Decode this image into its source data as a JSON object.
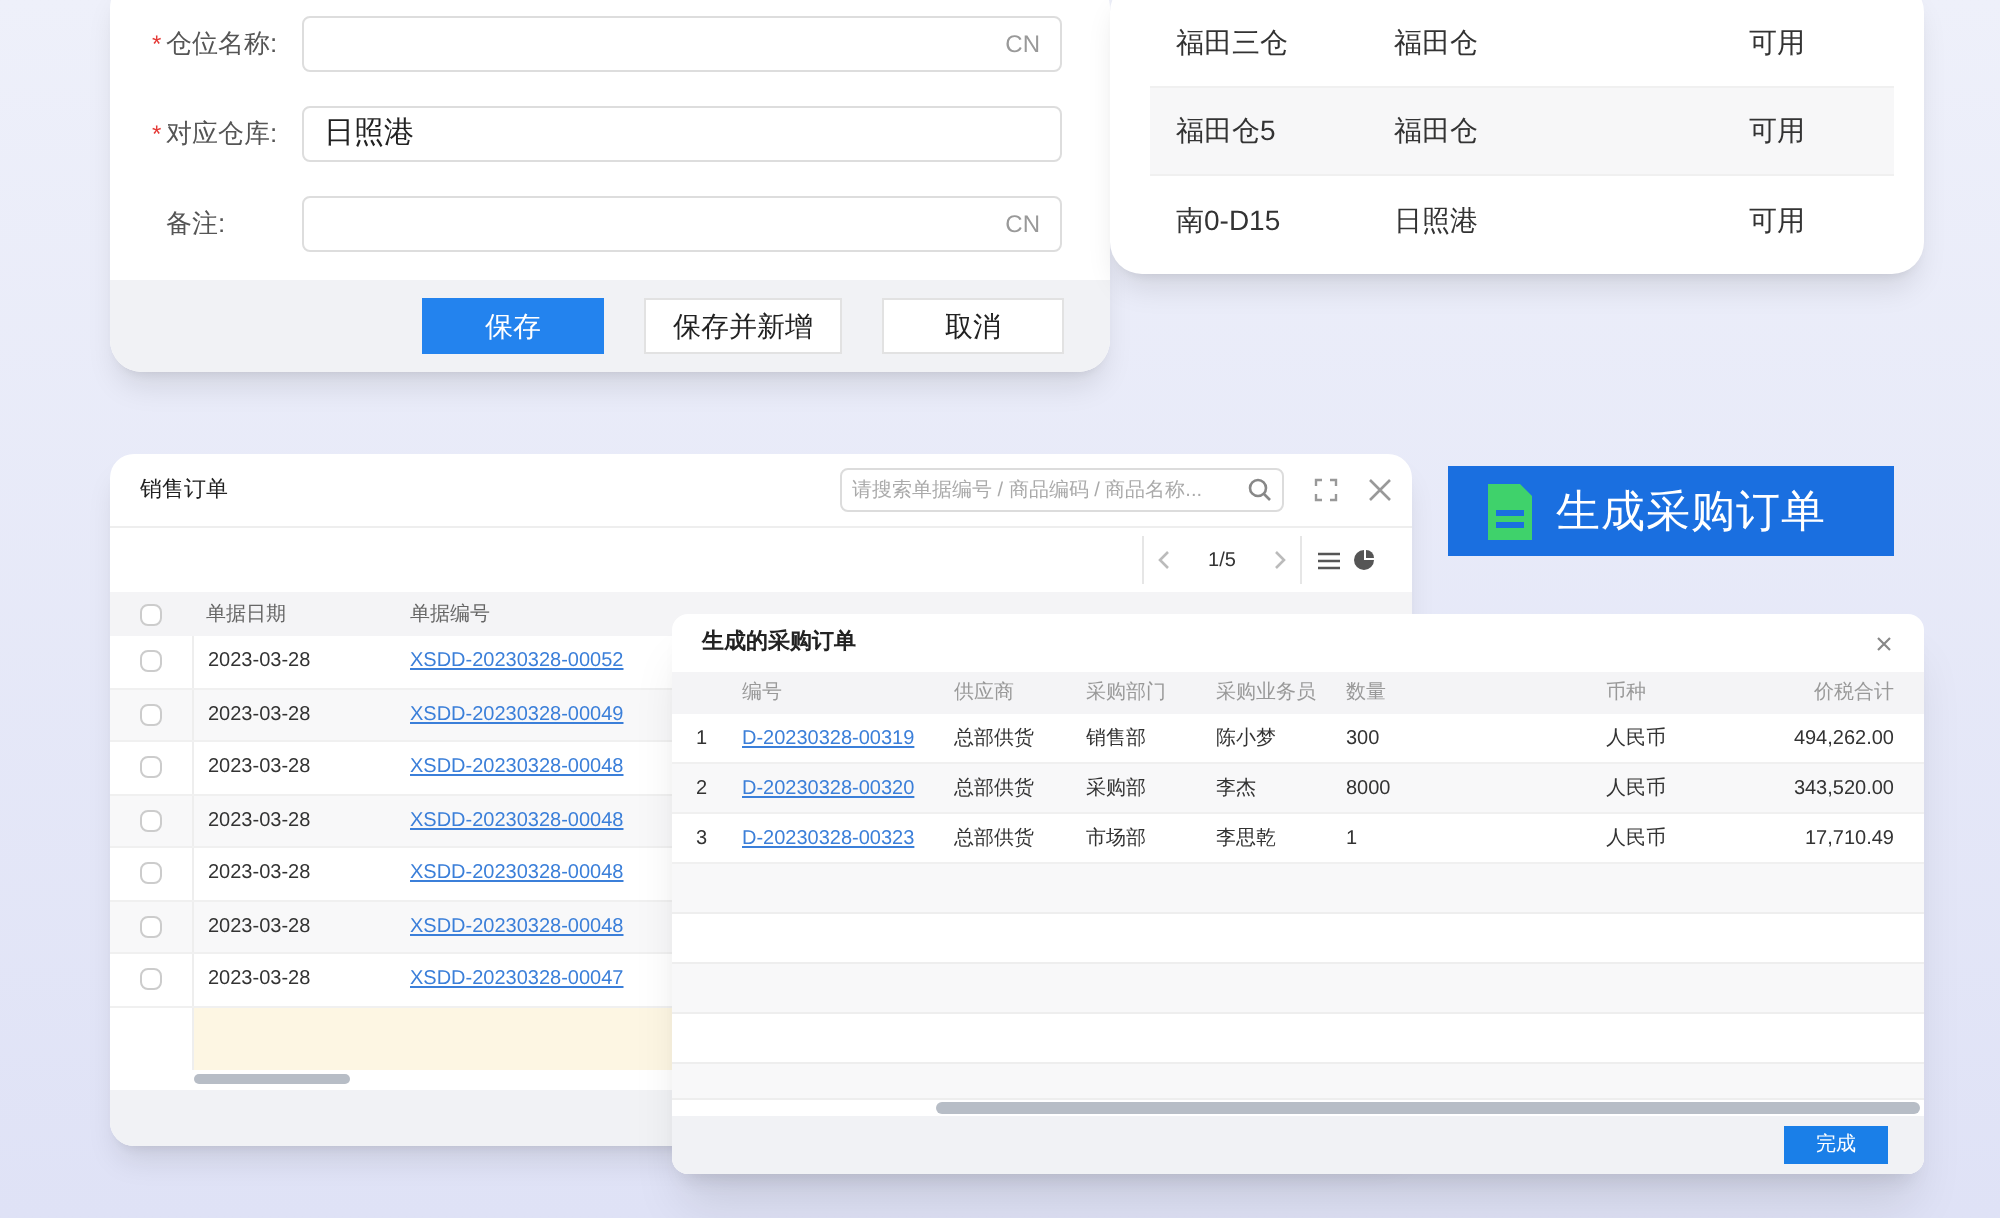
{
  "warehouse_form": {
    "fields": [
      {
        "required_mark": "*",
        "label": "仓位名称:",
        "suffix": "CN"
      },
      {
        "required_mark": "*",
        "label": "对应仓库:",
        "value": "日照港"
      },
      {
        "label": "备注:",
        "suffix": "CN"
      }
    ],
    "buttons": [
      {
        "label": "保存",
        "primary": true
      },
      {
        "label": "保存并新增",
        "primary": false
      },
      {
        "label": "取消",
        "primary": false
      }
    ]
  },
  "location_table": {
    "rows": [
      [
        "福田三仓",
        "福田仓",
        "可用"
      ],
      [
        "福田仓5",
        "福田仓",
        "可用"
      ],
      [
        "南0-D15",
        "日照港",
        "可用"
      ]
    ]
  },
  "banner": {
    "label": "生成采购订单"
  },
  "sales_order": {
    "title": "销售订单",
    "search": {
      "placeholder": "请搜索单据编号 / 商品编码 / 商品名称..."
    },
    "pager": "1/5",
    "select_all_checked": false,
    "columns": [
      "单据日期",
      "单据编号"
    ],
    "rows": [
      {
        "checked": false,
        "date": "2023-03-28",
        "number": "XSDD-20230328-00052"
      },
      {
        "checked": false,
        "date": "2023-03-28",
        "number": "XSDD-20230328-00049"
      },
      {
        "checked": false,
        "date": "2023-03-28",
        "number": "XSDD-20230328-00048"
      },
      {
        "checked": false,
        "date": "2023-03-28",
        "number": "XSDD-20230328-00048"
      },
      {
        "checked": false,
        "date": "2023-03-28",
        "number": "XSDD-20230328-00048"
      },
      {
        "checked": false,
        "date": "2023-03-28",
        "number": "XSDD-20230328-00048"
      },
      {
        "checked": false,
        "date": "2023-03-28",
        "number": "XSDD-20230328-00047"
      }
    ]
  },
  "purchase_order": {
    "title": "生成的采购订单",
    "columns": [
      "",
      "编号",
      "供应商",
      "采购部门",
      "采购业务员",
      "数量",
      "币种",
      "价税合计"
    ],
    "rows": [
      [
        "1",
        "D-20230328-00319",
        "总部供货",
        "销售部",
        "陈小梦",
        "300",
        "人民币",
        "494,262.00"
      ],
      [
        "2",
        "D-20230328-00320",
        "总部供货",
        "采购部",
        "李杰",
        "8000",
        "人民币",
        "343,520.00"
      ],
      [
        "3",
        "D-20230328-00323",
        "总部供货",
        "市场部",
        "李思乾",
        "1",
        "人民币",
        "17,710.49"
      ]
    ],
    "button": "完成"
  }
}
